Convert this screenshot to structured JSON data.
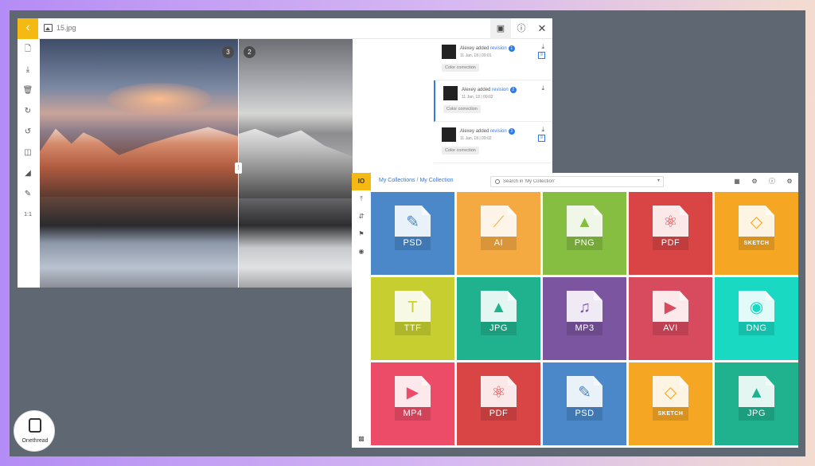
{
  "viewer": {
    "file_name": "15.jpg",
    "back_icon": "chevron-left-icon",
    "tabs": [
      "layers-icon",
      "info-icon",
      "close-icon"
    ],
    "tools": [
      "file-icon",
      "download-icon",
      "trash-icon",
      "redo-icon",
      "undo-icon",
      "flip-icon",
      "mirror-icon",
      "pen-icon",
      "ratio-label"
    ],
    "ratio_label": "1:1",
    "markers": [
      "3",
      "2"
    ],
    "revisions": [
      {
        "user": "Alexey",
        "action": "added",
        "link": "revision",
        "number": "1",
        "date": "11 Jan, 18 | 09:01",
        "tag": "Color correction"
      },
      {
        "user": "Alexey",
        "action": "added",
        "link": "revision",
        "number": "2",
        "date": "11 Jan, 18 | 09:02",
        "tag": "Color correction"
      },
      {
        "user": "Alexey",
        "action": "added",
        "link": "revision",
        "number": "3",
        "date": "11 Jan, 18 | 09:02",
        "tag": "Color correction"
      }
    ]
  },
  "collection": {
    "logo": "IO",
    "breadcrumb": {
      "root": "My Collections",
      "separator": "/",
      "current": "My Collection"
    },
    "search": {
      "placeholder": "Search in 'My Collection'"
    },
    "toolbar": [
      "view-grid-icon",
      "add-user-icon",
      "info-icon",
      "settings-icon"
    ],
    "side": [
      "upload-icon",
      "sort-icon",
      "tag-icon",
      "settings-dot-icon",
      "chat-icon"
    ],
    "tiles": [
      {
        "label": "PSD",
        "color": "#4a88c9",
        "glyph": "✎",
        "glyph_name": "brush-icon",
        "small": false
      },
      {
        "label": "AI",
        "color": "#f5a941",
        "glyph": "⟋",
        "glyph_name": "vector-icon",
        "small": false
      },
      {
        "label": "PNG",
        "color": "#86be42",
        "glyph": "▲",
        "glyph_name": "image-icon",
        "small": false
      },
      {
        "label": "PDF",
        "color": "#d94545",
        "glyph": "⚛",
        "glyph_name": "acrobat-icon",
        "small": false
      },
      {
        "label": "SKETCH",
        "color": "#f5a623",
        "glyph": "◇",
        "glyph_name": "diamond-icon",
        "small": true
      },
      {
        "label": "TTF",
        "color": "#c6cf2f",
        "glyph": "T",
        "glyph_name": "font-icon",
        "small": false
      },
      {
        "label": "JPG",
        "color": "#20b28e",
        "glyph": "▲",
        "glyph_name": "image-icon",
        "small": false
      },
      {
        "label": "MP3",
        "color": "#7b55a0",
        "glyph": "♫",
        "glyph_name": "music-icon",
        "small": false
      },
      {
        "label": "AVI",
        "color": "#d84a5e",
        "glyph": "▶",
        "glyph_name": "play-icon",
        "small": false
      },
      {
        "label": "DNG",
        "color": "#19d9c2",
        "glyph": "◉",
        "glyph_name": "disc-icon",
        "small": false
      },
      {
        "label": "MP4",
        "color": "#ec4c67",
        "glyph": "▶",
        "glyph_name": "video-icon",
        "small": false
      },
      {
        "label": "PDF",
        "color": "#d94545",
        "glyph": "⚛",
        "glyph_name": "acrobat-icon",
        "small": false
      },
      {
        "label": "PSD",
        "color": "#4a88c9",
        "glyph": "✎",
        "glyph_name": "brush-icon",
        "small": false
      },
      {
        "label": "SKETCH",
        "color": "#f5a623",
        "glyph": "◇",
        "glyph_name": "diamond-icon",
        "small": true
      },
      {
        "label": "JPG",
        "color": "#20b28e",
        "glyph": "▲",
        "glyph_name": "image-icon",
        "small": false
      }
    ]
  },
  "brand": {
    "name": "Onethread"
  },
  "colors": {
    "accent": "#f5b914",
    "link": "#2f7ae5",
    "backdrop": "#5f6872"
  }
}
